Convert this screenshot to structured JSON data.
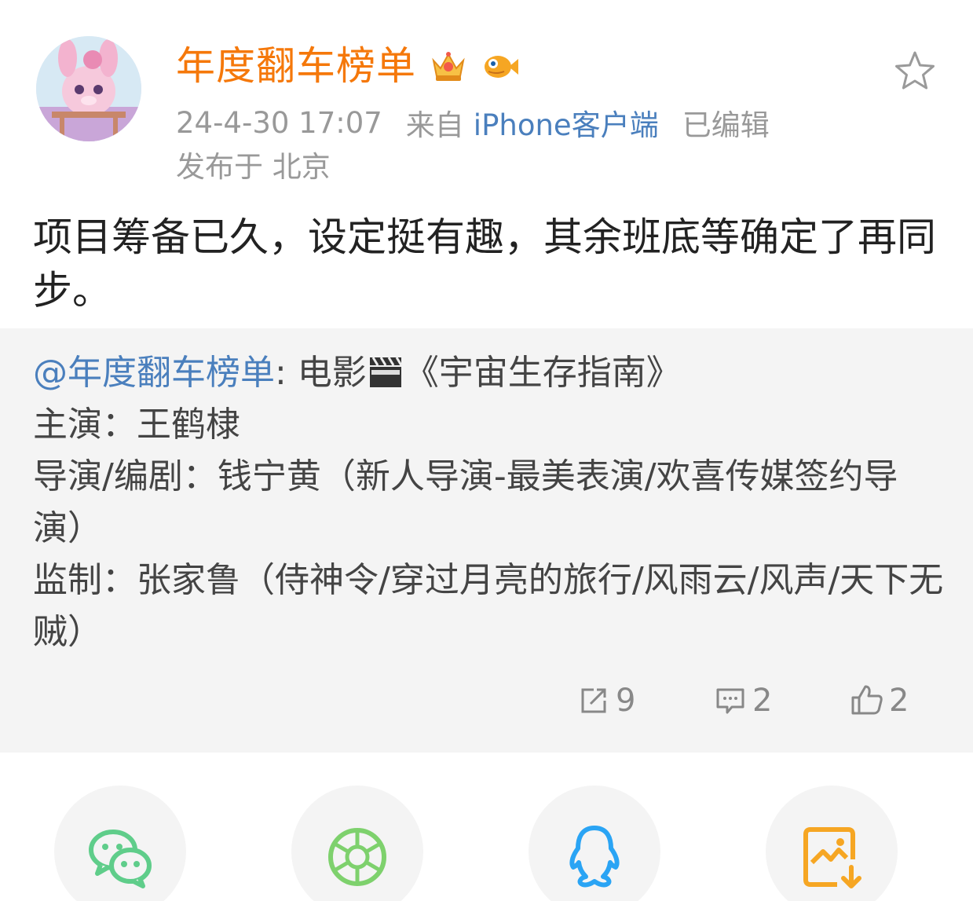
{
  "post": {
    "username": "年度翻车榜单",
    "timestamp": "24-4-30 17:07",
    "source_prefix": "来自",
    "source": "iPhone客户端",
    "edited": "已编辑",
    "location": "发布于 北京",
    "text": "项目筹备已久，设定挺有趣，其余班底等确定了再同步。",
    "badges": [
      "crown-badge-icon",
      "fish-badge-icon"
    ]
  },
  "quote": {
    "mention": "@年度翻车榜单",
    "line1_rest_a": ": 电影",
    "clapper_icon": "clapperboard-icon",
    "line1_rest_b": "《宇宙生存指南》",
    "line2": "主演：王鹤棣",
    "line3": "导演/编剧：钱宁黄（新人导演-最美表演/欢喜传媒签约导演）",
    "line4": "监制：张家鲁（侍神令/穿过月亮的旅行/风雨云/风声/天下无贼）",
    "reposts": "9",
    "comments": "2",
    "likes": "2"
  },
  "share": {
    "items": [
      "wechat-icon",
      "moments-icon",
      "qq-icon",
      "save-image-icon"
    ]
  },
  "colors": {
    "username": "#f5780a",
    "link": "#4a7fbd",
    "meta": "#999999",
    "quote_bg": "#f4f4f4",
    "wechat": "#5fcd8a",
    "moments": "#7ed16d",
    "qq": "#2aa4f4",
    "save": "#f6a623"
  }
}
